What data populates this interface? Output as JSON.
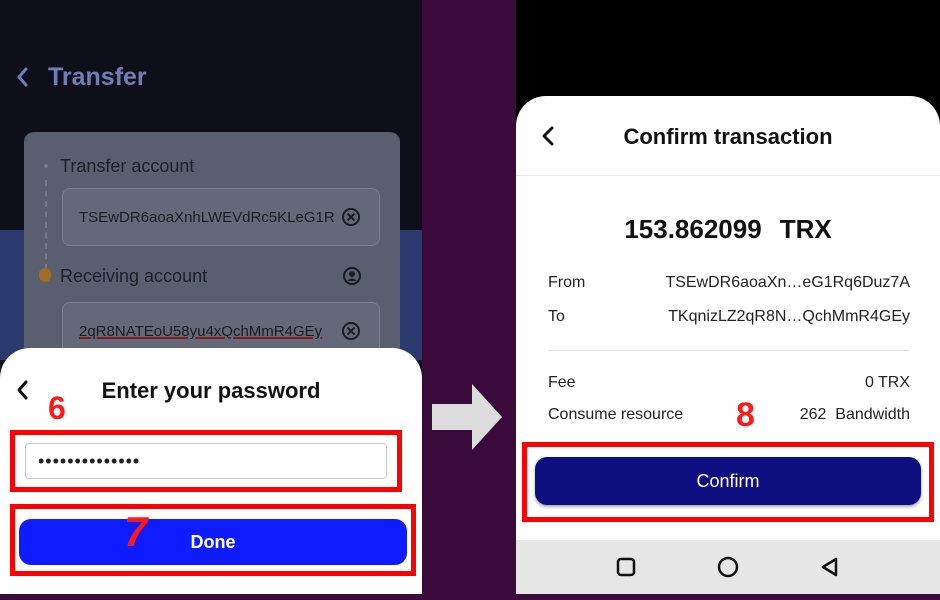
{
  "left_screen": {
    "header_title": "Transfer",
    "transfer_account_label": "Transfer account",
    "transfer_account_value": "TSEwDR6aoaXnhLWEVdRc5KLeG1R",
    "receiving_account_label": "Receiving account",
    "receiving_account_value": "2qR8NATEoU58yu4xQchMmR4GEy",
    "password_sheet": {
      "title": "Enter your password",
      "password_mask": "••••••••••••••",
      "done_label": "Done"
    }
  },
  "right_screen": {
    "title": "Confirm transaction",
    "amount": "153.862099",
    "currency": "TRX",
    "from_label": "From",
    "from_value": "TSEwDR6aoaXn…eG1Rq6Duz7A",
    "to_label": "To",
    "to_value": "TKqnizLZ2qR8N…QchMmR4GEy",
    "fee_label": "Fee",
    "fee_value": "0 TRX",
    "resource_label": "Consume resource",
    "resource_value": "262  Bandwidth",
    "confirm_label": "Confirm"
  },
  "annotations": {
    "step6": "6",
    "step7": "7",
    "step8": "8"
  },
  "colors": {
    "annotation_red": "#ff0000",
    "done_button_blue": "#0f1cff",
    "confirm_button_navy": "#0e0f80",
    "frame_background": "#3a0a3a"
  },
  "icons": [
    "back-chevron-icon",
    "clear-x-icon",
    "contact-icon",
    "arrow-right-icon",
    "nav-square-icon",
    "nav-circle-icon",
    "nav-triangle-icon"
  ]
}
